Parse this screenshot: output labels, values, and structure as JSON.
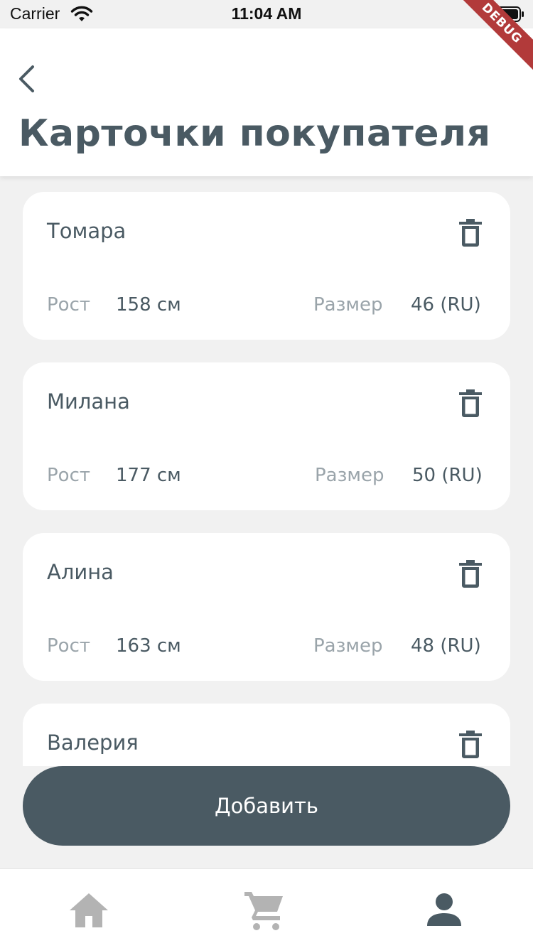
{
  "status_bar": {
    "carrier": "Carrier",
    "time": "11:04 AM"
  },
  "debug_banner": "DEBUG",
  "header": {
    "title": "Карточки покупателя"
  },
  "cards": [
    {
      "name": "Томара",
      "height_label": "Рост",
      "height_value": "158 см",
      "size_label": "Размер",
      "size_value": "46 (RU)"
    },
    {
      "name": "Милана",
      "height_label": "Рост",
      "height_value": "177 см",
      "size_label": "Размер",
      "size_value": "50 (RU)"
    },
    {
      "name": "Алина",
      "height_label": "Рост",
      "height_value": "163 см",
      "size_label": "Размер",
      "size_value": "48 (RU)"
    },
    {
      "name": "Валерия"
    }
  ],
  "add_button": {
    "label": "Добавить"
  },
  "bottom_nav": {
    "items": [
      {
        "icon": "home-icon",
        "active": false
      },
      {
        "icon": "cart-icon",
        "active": false
      },
      {
        "icon": "person-icon",
        "active": true
      }
    ]
  },
  "colors": {
    "primary": "#4a5a63",
    "muted": "#9aa4aa",
    "inactive_icon": "#b3b3b3",
    "background": "#f1f1f1",
    "card": "#ffffff",
    "debug_ribbon": "#b23a3a"
  }
}
